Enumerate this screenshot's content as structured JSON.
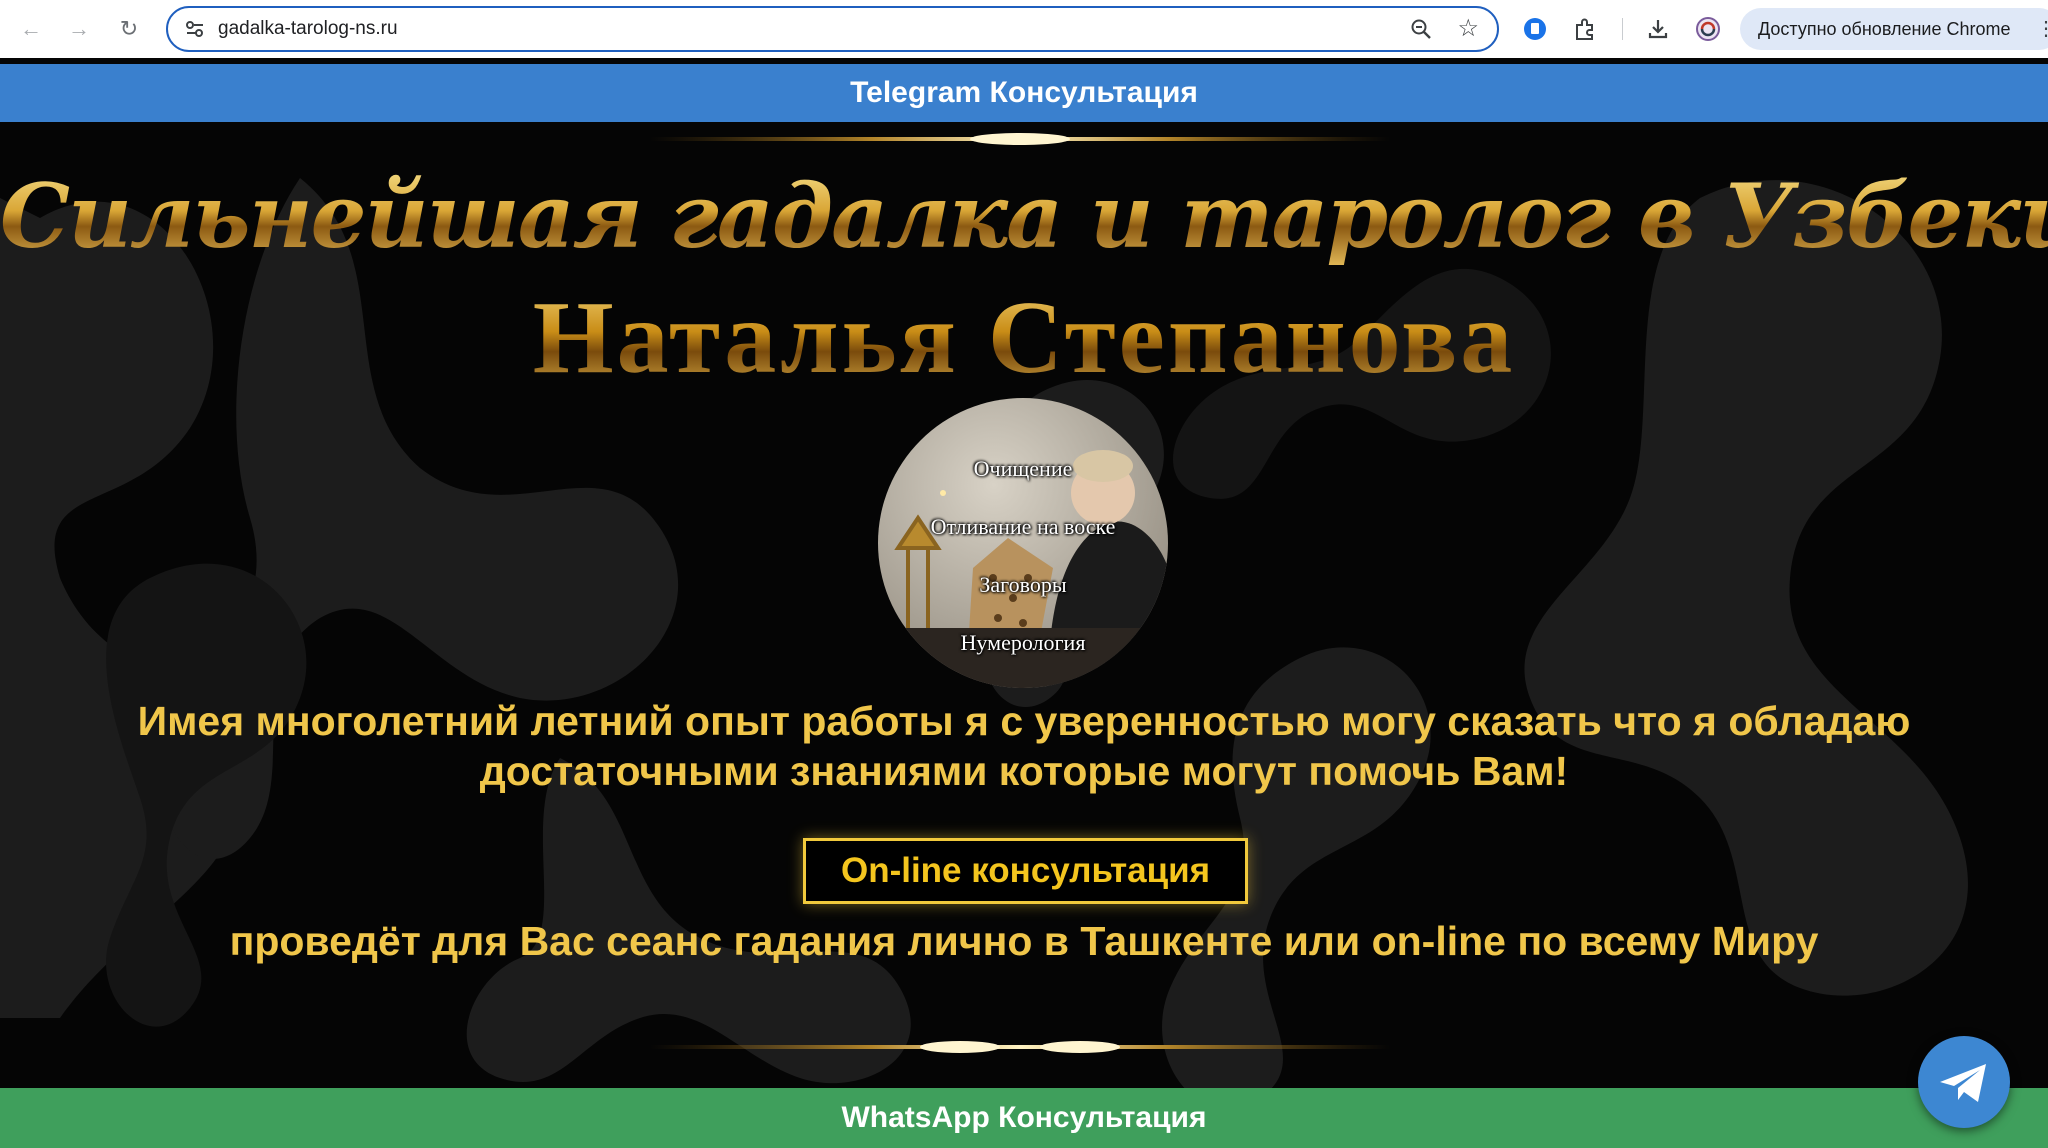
{
  "browser": {
    "url": "gadalka-tarolog-ns.ru",
    "update_button": "Доступно обновление Chrome"
  },
  "page": {
    "telegram_bar": "Telegram Консультация",
    "headline": "Сильнейшая гадалка и таролог в Узбекистане",
    "name": "Наталья Степанова",
    "avatar_labels": [
      "Очищение",
      "Отливание на воске",
      "Заговоры",
      "Нумерология"
    ],
    "lead_line_1": "Имея многолетний летний опыт работы я с уверенностью могу сказать что я обладаю",
    "lead_line_2": "достаточными знаниями которые могут помочь Вам!",
    "cta_button": "On-line консультация",
    "sub_text": "проведёт для Вас сеанс гадания лично в Ташкенте или on-line по всему Миру",
    "whatsapp_bar": "WhatsApp Консультация"
  },
  "colors": {
    "telegram_blue": "#3a80ce",
    "whatsapp_green": "#3f9f5c",
    "gold": "#f0c64a",
    "background": "#050505"
  }
}
